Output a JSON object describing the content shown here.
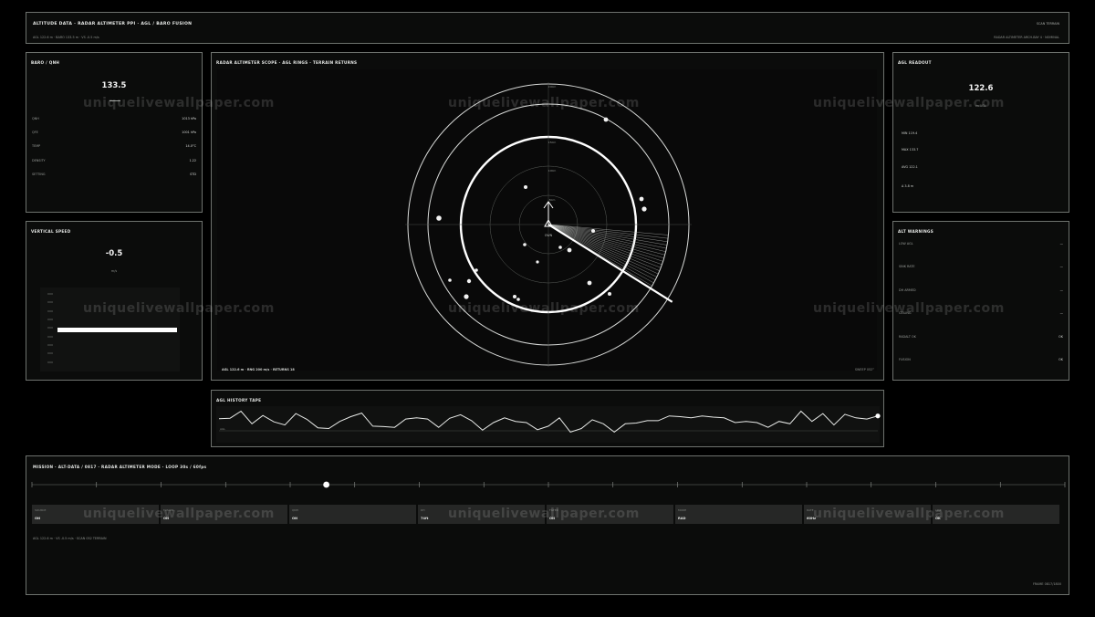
{
  "header": {
    "title": "ALTITUDE DATA · RADAR ALTIMETER PPI · AGL / BARO FUSION",
    "subline": "AGL 122.6 m · BARO 133.5 m · VS -0.5 m/s",
    "right_top": "SCAN TERRAIN",
    "right_sub": "RADAR ALTIMETER ARCH-BAY 4 · NOMINAL"
  },
  "baro": {
    "title": "BARO / QNH",
    "value": "133.5",
    "rows": [
      {
        "k": "QNH",
        "v": "1013 hPa"
      },
      {
        "k": "QFE",
        "v": "1001 hPa"
      },
      {
        "k": "TEMP",
        "v": "14.0°C"
      },
      {
        "k": "DENSITY",
        "v": "1.22"
      },
      {
        "k": "SETTING",
        "v": "STD"
      }
    ]
  },
  "vertical_speed": {
    "title": "VERTICAL SPEED",
    "value": "-0.5",
    "unit": "m/s",
    "level_percent": 50
  },
  "radar": {
    "title": "RADAR ALTIMETER SCOPE · AGL RINGS · TERRAIN RETURNS",
    "center_label": "OWN",
    "ring_labels": [
      "200m",
      "150m",
      "100m",
      "50m"
    ],
    "footer_left": "AGL 122.6 m · RNG 200 m/s · RETURNS 18",
    "footer_right": "SWEEP 052°"
  },
  "agl_readout": {
    "title": "AGL READOUT",
    "value": "122.6",
    "unit": "m AGL",
    "rows": [
      "MIN 119.4",
      "MAX 133.7",
      "AVG 122.1",
      "Δ 3.8 m"
    ]
  },
  "warnings": {
    "title": "ALT WARNINGS",
    "items": [
      {
        "label": "LOW AGL",
        "state": "—"
      },
      {
        "label": "SINK RATE",
        "state": "—"
      },
      {
        "label": "DH ARMED",
        "state": "—"
      },
      {
        "label": "CEILING",
        "state": "—"
      },
      {
        "label": "RADALT OK",
        "state": "OK"
      },
      {
        "label": "FUSION",
        "state": "OK"
      }
    ]
  },
  "history": {
    "title": "AGL HISTORY TAPE",
    "axis_label": "AGL",
    "values": [
      0.66,
      0.68,
      0.98,
      0.45,
      0.8,
      0.53,
      0.4,
      0.88,
      0.64,
      0.28,
      0.25,
      0.55,
      0.75,
      0.9,
      0.35,
      0.33,
      0.3,
      0.65,
      0.7,
      0.65,
      0.3,
      0.68,
      0.83,
      0.58,
      0.18,
      0.5,
      0.7,
      0.55,
      0.5,
      0.2,
      0.35,
      0.7,
      0.1,
      0.25,
      0.62,
      0.45,
      0.1,
      0.45,
      0.48,
      0.58,
      0.58,
      0.78,
      0.75,
      0.7,
      0.78,
      0.73,
      0.7,
      0.5,
      0.55,
      0.5,
      0.3,
      0.55,
      0.45,
      0.98,
      0.55,
      0.88,
      0.4,
      0.85,
      0.7,
      0.65,
      0.78
    ]
  },
  "timeline": {
    "title": "MISSION · ALT-DATA / 0817 · RADAR ALTIMETER MODE · LOOP 30s / 60fps",
    "marker_fraction": 0.285,
    "cells": [
      {
        "label": "SOURCE",
        "value": "ON"
      },
      {
        "label": "FUSION",
        "value": "ON"
      },
      {
        "label": "QNH",
        "value": "ON"
      },
      {
        "label": "DH",
        "value": "74ft"
      },
      {
        "label": "FILTER",
        "value": "ON"
      },
      {
        "label": "MODE",
        "value": "RAD"
      },
      {
        "label": "RATE",
        "value": "60Hz"
      },
      {
        "label": "LINK",
        "value": "OK"
      }
    ],
    "footnote": "AGL 122.6 m · VS -0.5 m/s · SCAN 052 TERRAIN",
    "corner": "FRAME 0817/1800"
  },
  "watermark": "uniquelivewallpaper.com"
}
